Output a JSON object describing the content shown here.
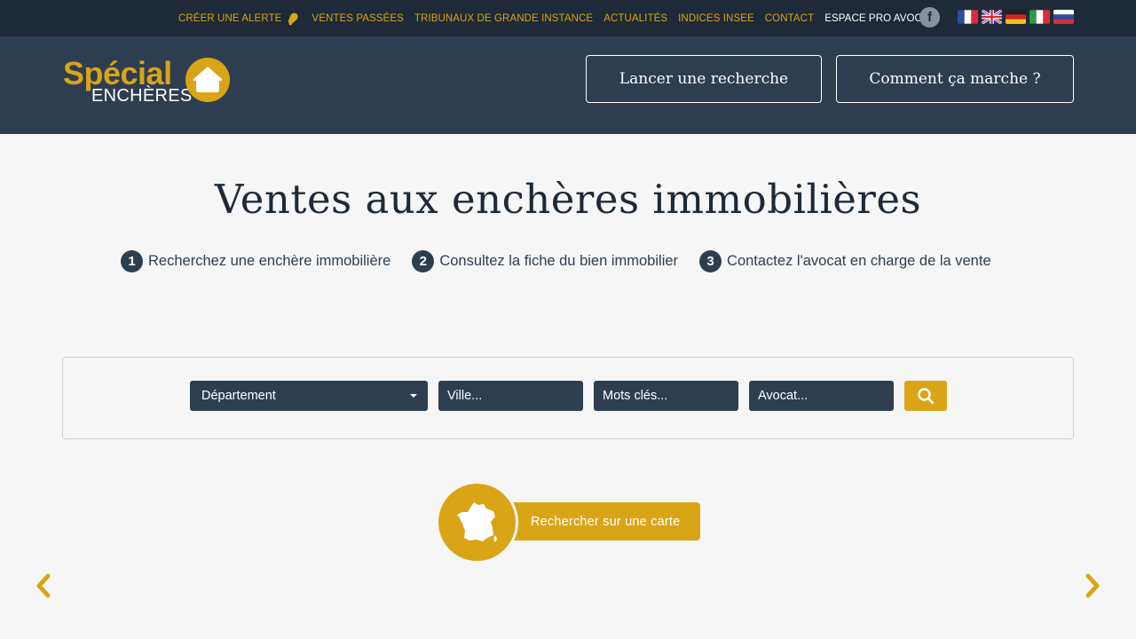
{
  "topnav": {
    "items": [
      {
        "label": "CRÉER UNE ALERTE"
      },
      {
        "label": "VENTES PASSÉES"
      },
      {
        "label": "TRIBUNAUX DE GRANDE INSTANCE"
      },
      {
        "label": "ACTUALITÉS"
      },
      {
        "label": "INDICES INSEE"
      },
      {
        "label": "CONTACT"
      },
      {
        "label": "ESPACE PRO AVOCAT"
      }
    ],
    "facebook_icon": "facebook-icon",
    "languages": [
      "fr",
      "en",
      "de",
      "it",
      "ru"
    ]
  },
  "logo": {
    "top": "Spécial",
    "bottom": "ENCHÈRES",
    "icon": "house-icon"
  },
  "header": {
    "search_button": "Lancer une recherche",
    "how_button": "Comment ça marche ?"
  },
  "hero": {
    "title": "Ventes aux enchères immobilières",
    "steps": [
      {
        "num": "1",
        "text": "Recherchez une enchère immobilière"
      },
      {
        "num": "2",
        "text": "Consultez la fiche du bien immobilier"
      },
      {
        "num": "3",
        "text": "Contactez l'avocat en charge de la vente"
      }
    ]
  },
  "search": {
    "department_selected": "Département",
    "city_placeholder": "Ville...",
    "keywords_placeholder": "Mots clés...",
    "lawyer_placeholder": "Avocat...",
    "submit_icon": "search-icon"
  },
  "map": {
    "label": "Rechercher sur une carte",
    "icon": "france-map-icon"
  },
  "colors": {
    "gold": "#d9a416",
    "navy": "#2d3e50",
    "topbar": "#1e2a38",
    "background": "#f6f6f6"
  }
}
